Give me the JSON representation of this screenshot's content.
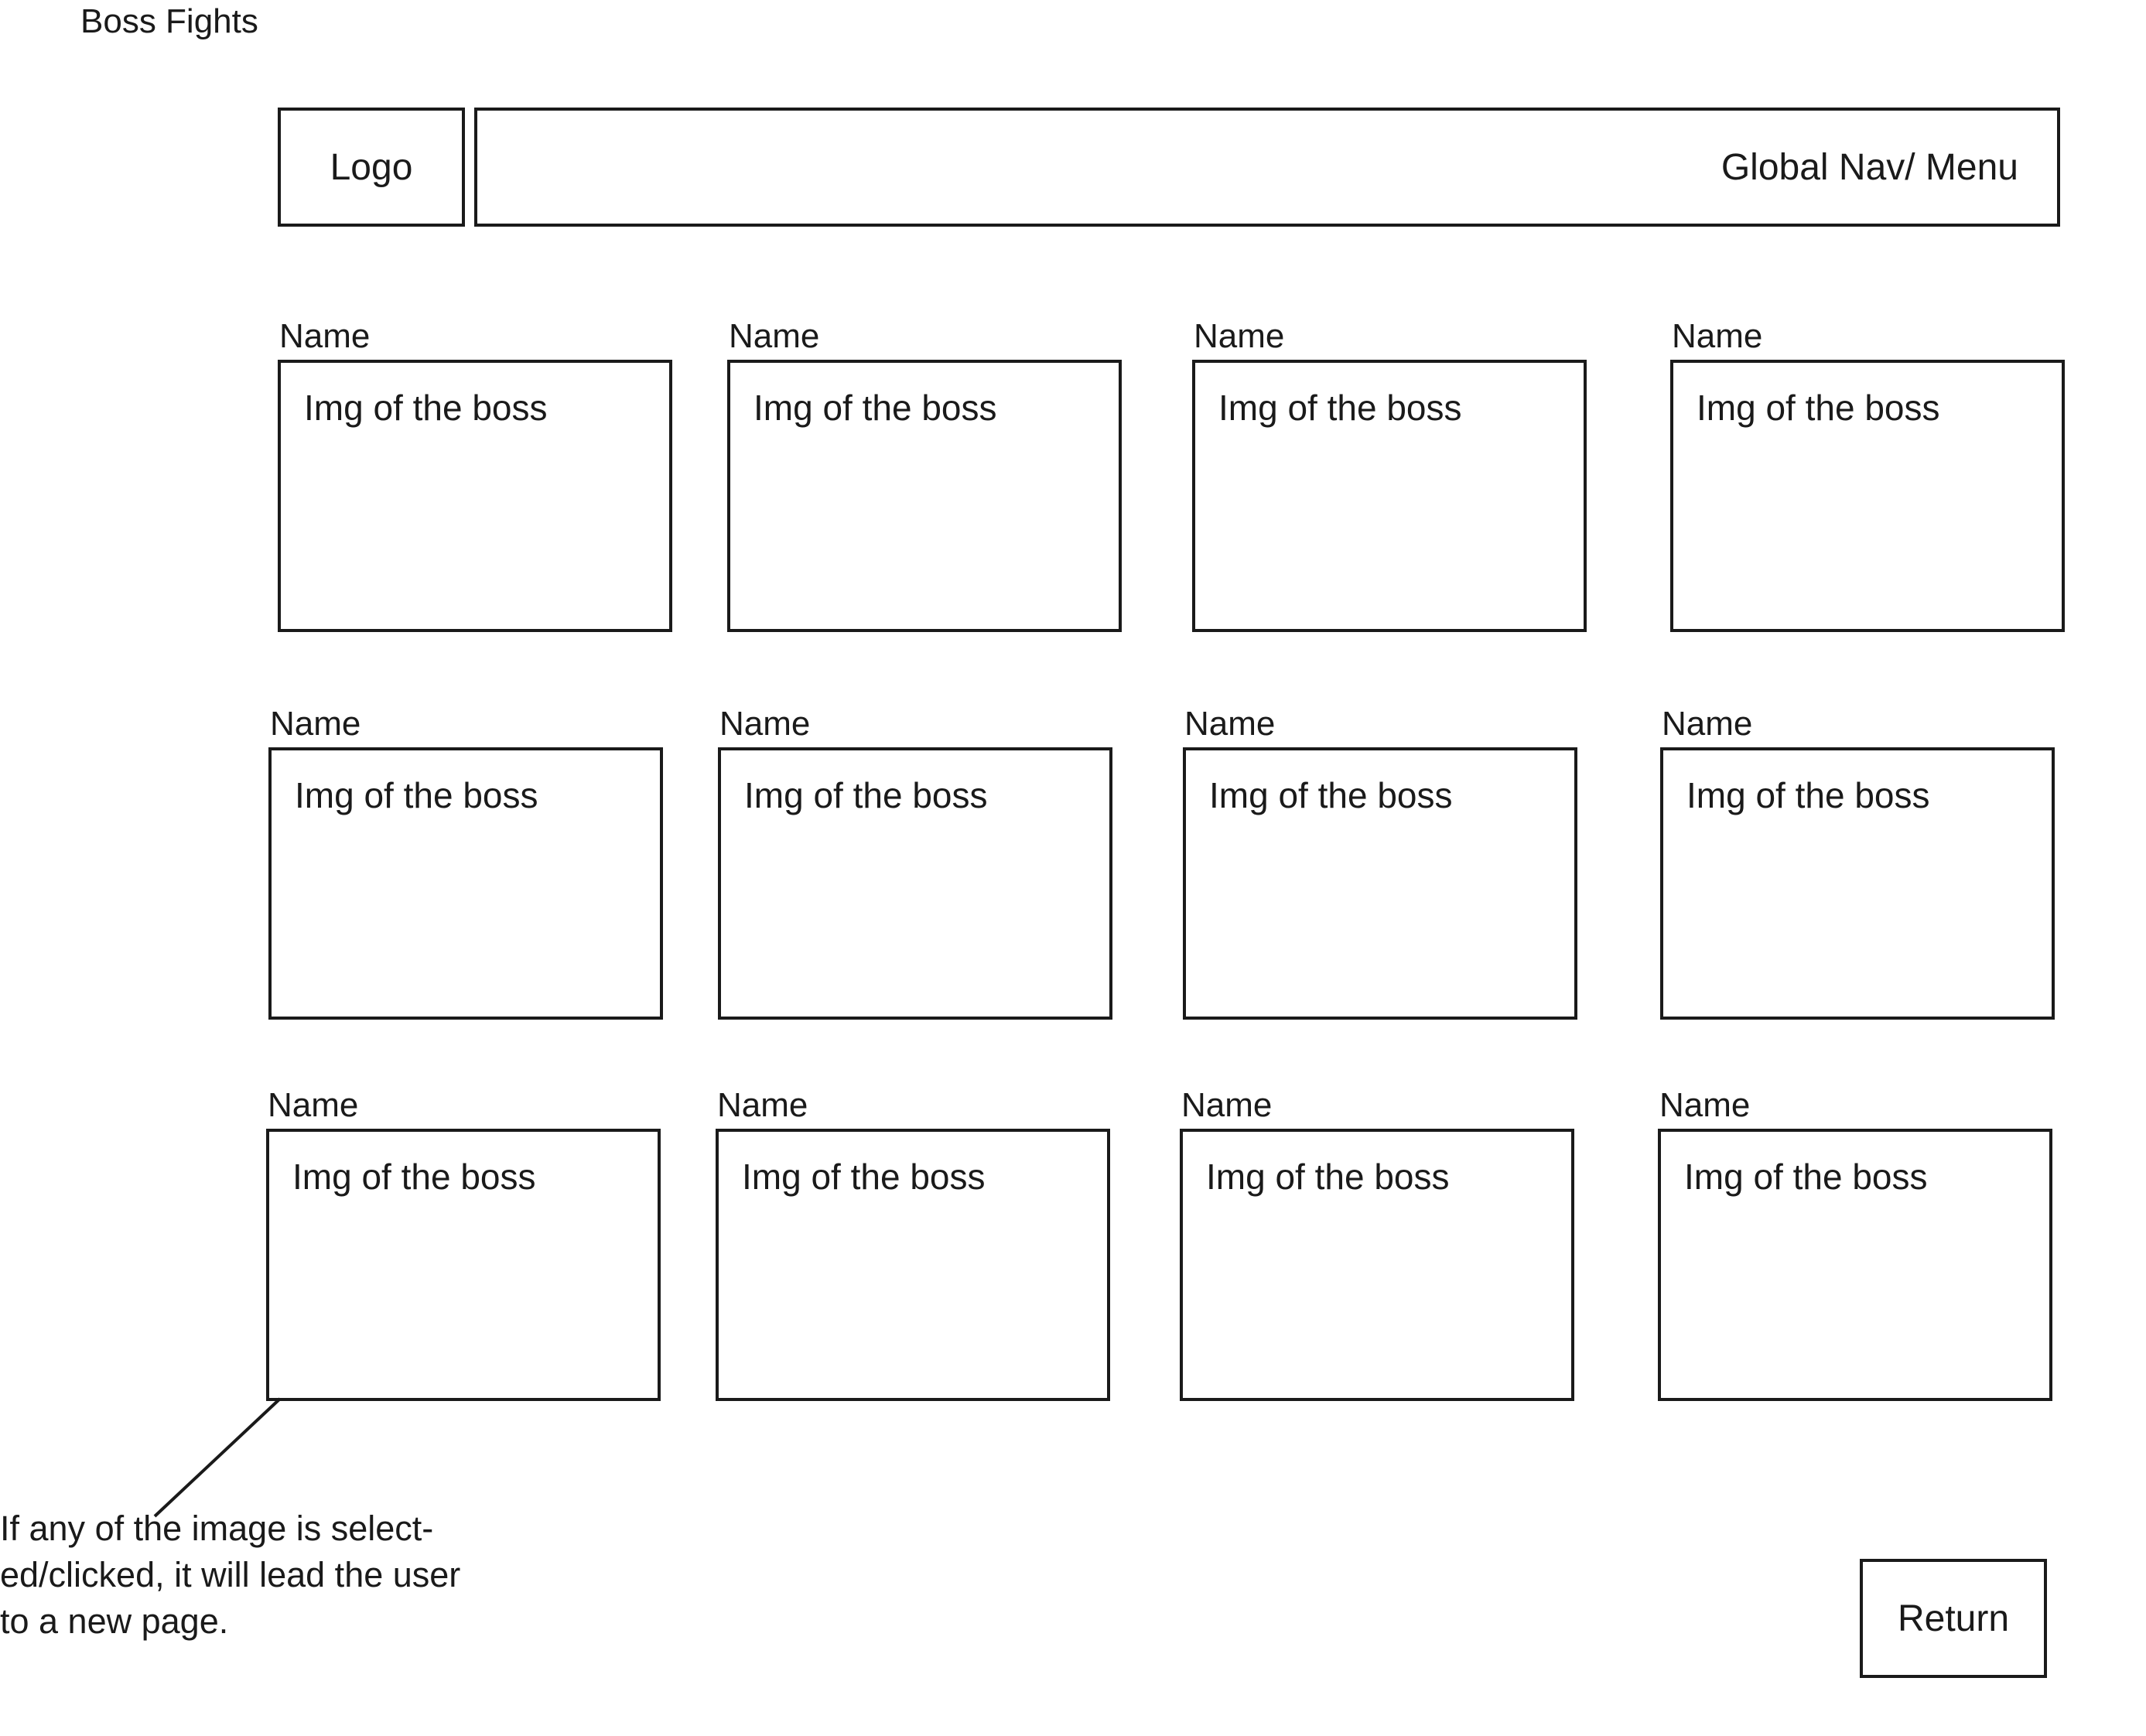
{
  "page": {
    "title": "Boss Fights"
  },
  "header": {
    "logo_label": "Logo",
    "nav_label": "Global Nav/ Menu"
  },
  "grid": {
    "rows": [
      [
        {
          "name": "Name",
          "image_label": "Img of the boss"
        },
        {
          "name": "Name",
          "image_label": "Img of the boss"
        },
        {
          "name": "Name",
          "image_label": "Img of the boss"
        },
        {
          "name": "Name",
          "image_label": "Img of the boss"
        }
      ],
      [
        {
          "name": "Name",
          "image_label": "Img of the boss"
        },
        {
          "name": "Name",
          "image_label": "Img of the boss"
        },
        {
          "name": "Name",
          "image_label": "Img of the boss"
        },
        {
          "name": "Name",
          "image_label": "Img of the boss"
        }
      ],
      [
        {
          "name": "Name",
          "image_label": "Img of the boss"
        },
        {
          "name": "Name",
          "image_label": "Img of the boss"
        },
        {
          "name": "Name",
          "image_label": "Img of the boss"
        },
        {
          "name": "Name",
          "image_label": "Img of the boss"
        }
      ]
    ]
  },
  "annotation": {
    "text": "If any of the image is select-ed/clicked, it will lead the user to a new page."
  },
  "footer": {
    "return_label": "Return"
  }
}
